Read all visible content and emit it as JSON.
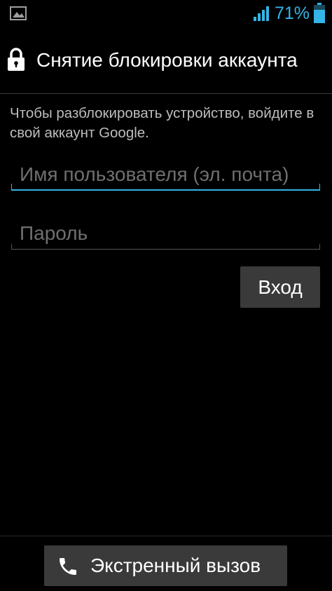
{
  "status_bar": {
    "battery_percent": "71%",
    "accent_color": "#33b5e5",
    "icons": [
      "picture-icon",
      "signal-icon",
      "battery-icon"
    ]
  },
  "header": {
    "icon": "lock-icon",
    "title": "Снятие блокировки аккаунта"
  },
  "instructions": "Чтобы разблокировать устройство, войдите в свой аккаунт Google.",
  "form": {
    "username": {
      "value": "",
      "placeholder": "Имя пользователя (эл. почта)"
    },
    "password": {
      "value": "",
      "placeholder": "Пароль"
    },
    "login_label": "Вход"
  },
  "footer": {
    "emergency_icon": "phone-icon",
    "emergency_label": "Экстренный вызов"
  }
}
